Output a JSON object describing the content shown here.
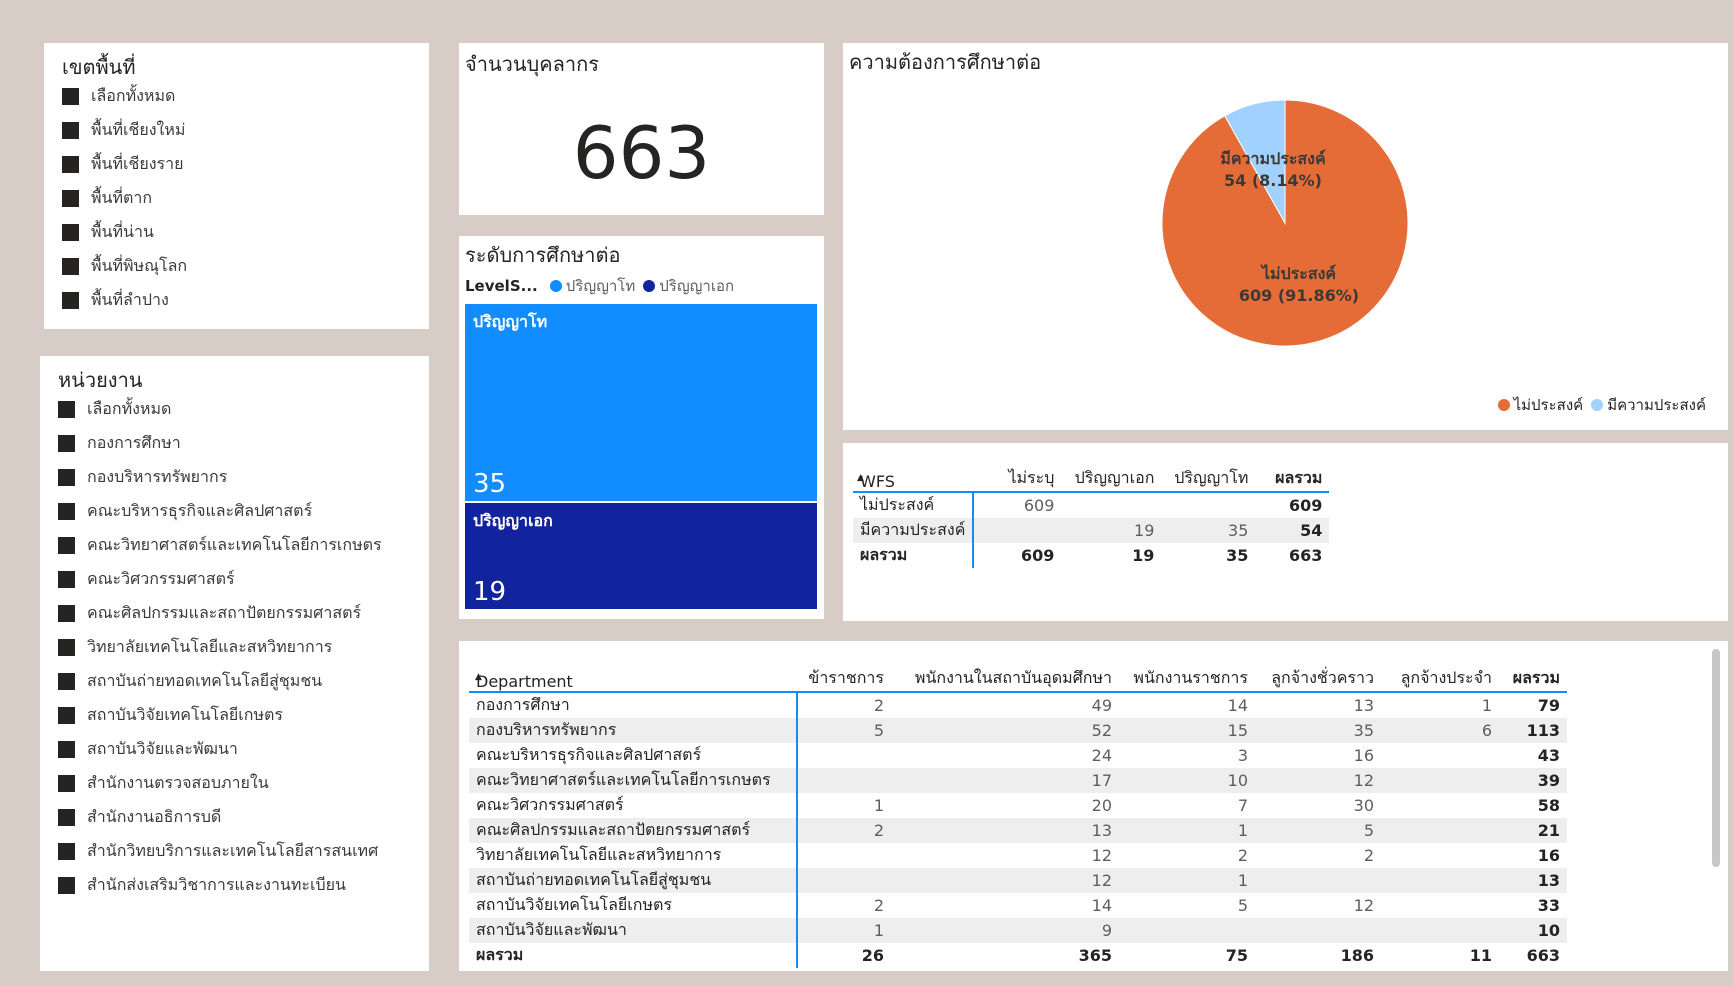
{
  "area_slicer": {
    "title": "เขตพื้นที่",
    "items": [
      "เลือกทั้งหมด",
      "พื้นที่เชียงใหม่",
      "พื้นที่เชียงราย",
      "พื้นที่ตาก",
      "พื้นที่น่าน",
      "พื้นที่พิษณุโลก",
      "พื้นที่ลำปาง"
    ]
  },
  "dept_slicer": {
    "title": "หน่วยงาน",
    "items": [
      "เลือกทั้งหมด",
      "กองการศึกษา",
      "กองบริหารทรัพยากร",
      "คณะบริหารธุรกิจและศิลปศาสตร์",
      "คณะวิทยาศาสตร์และเทคโนโลยีการเกษตร",
      "คณะวิศวกรรมศาสตร์",
      "คณะศิลปกรรมและสถาปัตยกรรมศาสตร์",
      "วิทยาลัยเทคโนโลยีและสหวิทยาการ",
      "สถาบันถ่ายทอดเทคโนโลยีสู่ชุมชน",
      "สถาบันวิจัยเทคโนโลยีเกษตร",
      "สถาบันวิจัยและพัฒนา",
      "สำนักงานตรวจสอบภายใน",
      "สำนักงานอธิการบดี",
      "สำนักวิทยบริการและเทคโนโลยีสารสนเทศ",
      "สำนักส่งเสริมวิชาการและงานทะเบียน"
    ]
  },
  "kpi": {
    "title": "จำนวนบุคลากร",
    "value": "663"
  },
  "treemap": {
    "title": "ระดับการศึกษาต่อ",
    "legend_title": "LevelS...",
    "legend": [
      {
        "name": "ปริญญาโท",
        "color": "#118dff"
      },
      {
        "name": "ปริญญาเอก",
        "color": "#12239e"
      }
    ]
  },
  "pie": {
    "title": "ความต้องการศึกษาต่อ",
    "legend": [
      {
        "name": "ไม่ประสงค์",
        "color": "#e66c37"
      },
      {
        "name": "มีความประสงค์",
        "color": "#a0d1ff"
      }
    ],
    "labels": [
      {
        "line1": "มีความประสงค์",
        "line2": "54 (8.14%)"
      },
      {
        "line1": "ไม่ประสงค์",
        "line2": "609 (91.86%)"
      }
    ]
  },
  "chart_data": [
    {
      "type": "pie",
      "title": "ความต้องการศึกษาต่อ",
      "categories": [
        "ไม่ประสงค์",
        "มีความประสงค์"
      ],
      "values": [
        609,
        54
      ],
      "percent": [
        91.86,
        8.14
      ],
      "legend": "bottom-right"
    },
    {
      "type": "treemap",
      "title": "ระดับการศึกษาต่อ",
      "categories": [
        "ปริญญาโท",
        "ปริญญาเอก"
      ],
      "values": [
        35,
        19
      ]
    }
  ],
  "wfs_matrix": {
    "headers": [
      "WFS",
      "ไม่ระบุ",
      "ปริญญาเอก",
      "ปริญญาโท",
      "ผลรวม"
    ],
    "rows": [
      [
        "ไม่ประสงค์",
        "609",
        "",
        "",
        "609"
      ],
      [
        "มีความประสงค์",
        "",
        "19",
        "35",
        "54"
      ]
    ],
    "total": [
      "ผลรวม",
      "609",
      "19",
      "35",
      "663"
    ]
  },
  "dept_matrix": {
    "headers": [
      "Department",
      "ข้าราชการ",
      "พนักงานในสถาบันอุดมศึกษา",
      "พนักงานราชการ",
      "ลูกจ้างชั่วคราว",
      "ลูกจ้างประจำ",
      "ผลรวม"
    ],
    "rows": [
      [
        "กองการศึกษา",
        "2",
        "49",
        "14",
        "13",
        "1",
        "79"
      ],
      [
        "กองบริหารทรัพยากร",
        "5",
        "52",
        "15",
        "35",
        "6",
        "113"
      ],
      [
        "คณะบริหารธุรกิจและศิลปศาสตร์",
        "",
        "24",
        "3",
        "16",
        "",
        "43"
      ],
      [
        "คณะวิทยาศาสตร์และเทคโนโลยีการเกษตร",
        "",
        "17",
        "10",
        "12",
        "",
        "39"
      ],
      [
        "คณะวิศวกรรมศาสตร์",
        "1",
        "20",
        "7",
        "30",
        "",
        "58"
      ],
      [
        "คณะศิลปกรรมและสถาปัตยกรรมศาสตร์",
        "2",
        "13",
        "1",
        "5",
        "",
        "21"
      ],
      [
        "วิทยาลัยเทคโนโลยีและสหวิทยาการ",
        "",
        "12",
        "2",
        "2",
        "",
        "16"
      ],
      [
        "สถาบันถ่ายทอดเทคโนโลยีสู่ชุมชน",
        "",
        "12",
        "1",
        "",
        "",
        "13"
      ],
      [
        "สถาบันวิจัยเทคโนโลยีเกษตร",
        "2",
        "14",
        "5",
        "12",
        "",
        "33"
      ],
      [
        "สถาบันวิจัยและพัฒนา",
        "1",
        "9",
        "",
        "",
        "",
        "10"
      ]
    ],
    "total": [
      "ผลรวม",
      "26",
      "365",
      "75",
      "186",
      "11",
      "663"
    ]
  }
}
